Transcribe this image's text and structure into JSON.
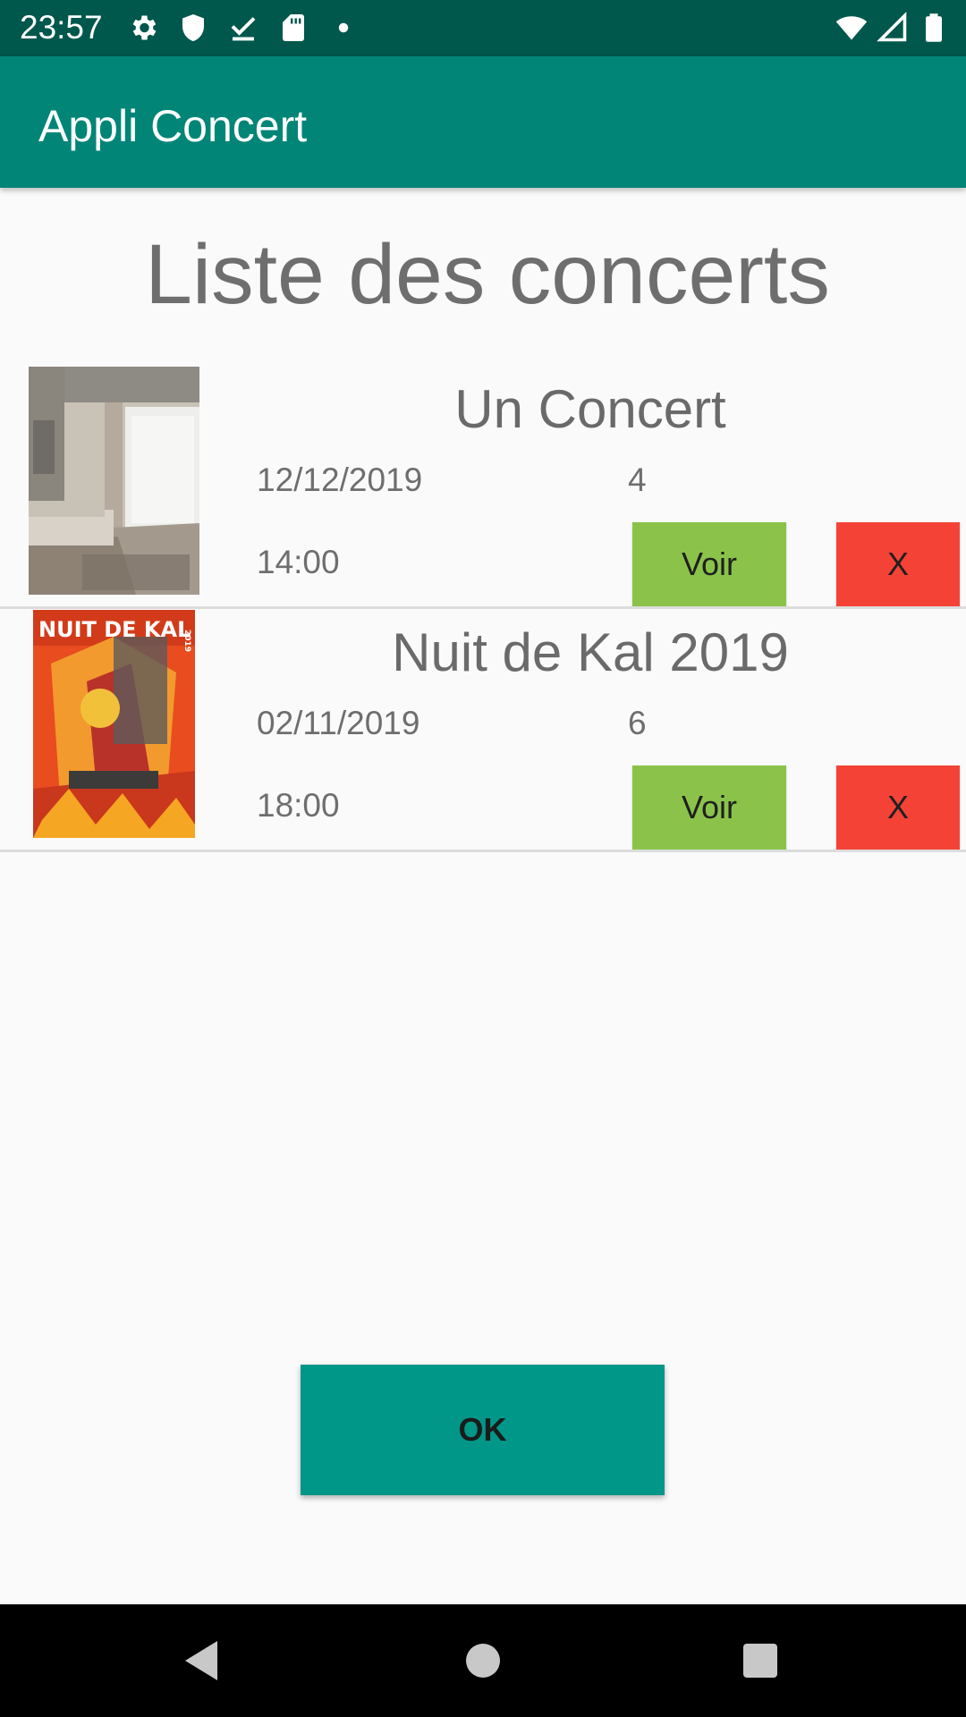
{
  "status_bar": {
    "time": "23:57",
    "left_icons": [
      "settings-icon",
      "shield-icon",
      "download-done-icon",
      "sd-card-icon",
      "dot-icon"
    ],
    "right_icons": [
      "wifi-icon",
      "signal-icon",
      "battery-icon"
    ]
  },
  "app_bar": {
    "title": "Appli Concert"
  },
  "page": {
    "title": "Liste des concerts"
  },
  "concerts": [
    {
      "name": "Un Concert",
      "date": "12/12/2019",
      "time": "14:00",
      "count": "4",
      "image": "room-photo",
      "view_label": "Voir",
      "delete_label": "X"
    },
    {
      "name": "Nuit de Kal 2019",
      "date": "02/11/2019",
      "time": "18:00",
      "count": "6",
      "image": "concert-poster",
      "poster_text": "NUIT DE KAL 2019",
      "view_label": "Voir",
      "delete_label": "X"
    }
  ],
  "footer": {
    "ok_label": "OK"
  },
  "nav_bar": {
    "icons": [
      "back-icon",
      "home-icon",
      "recents-icon"
    ]
  },
  "colors": {
    "status_bar": "#00574b",
    "app_bar": "#008577",
    "view_button": "#8bc34a",
    "delete_button": "#f44336",
    "ok_button": "#009688"
  }
}
